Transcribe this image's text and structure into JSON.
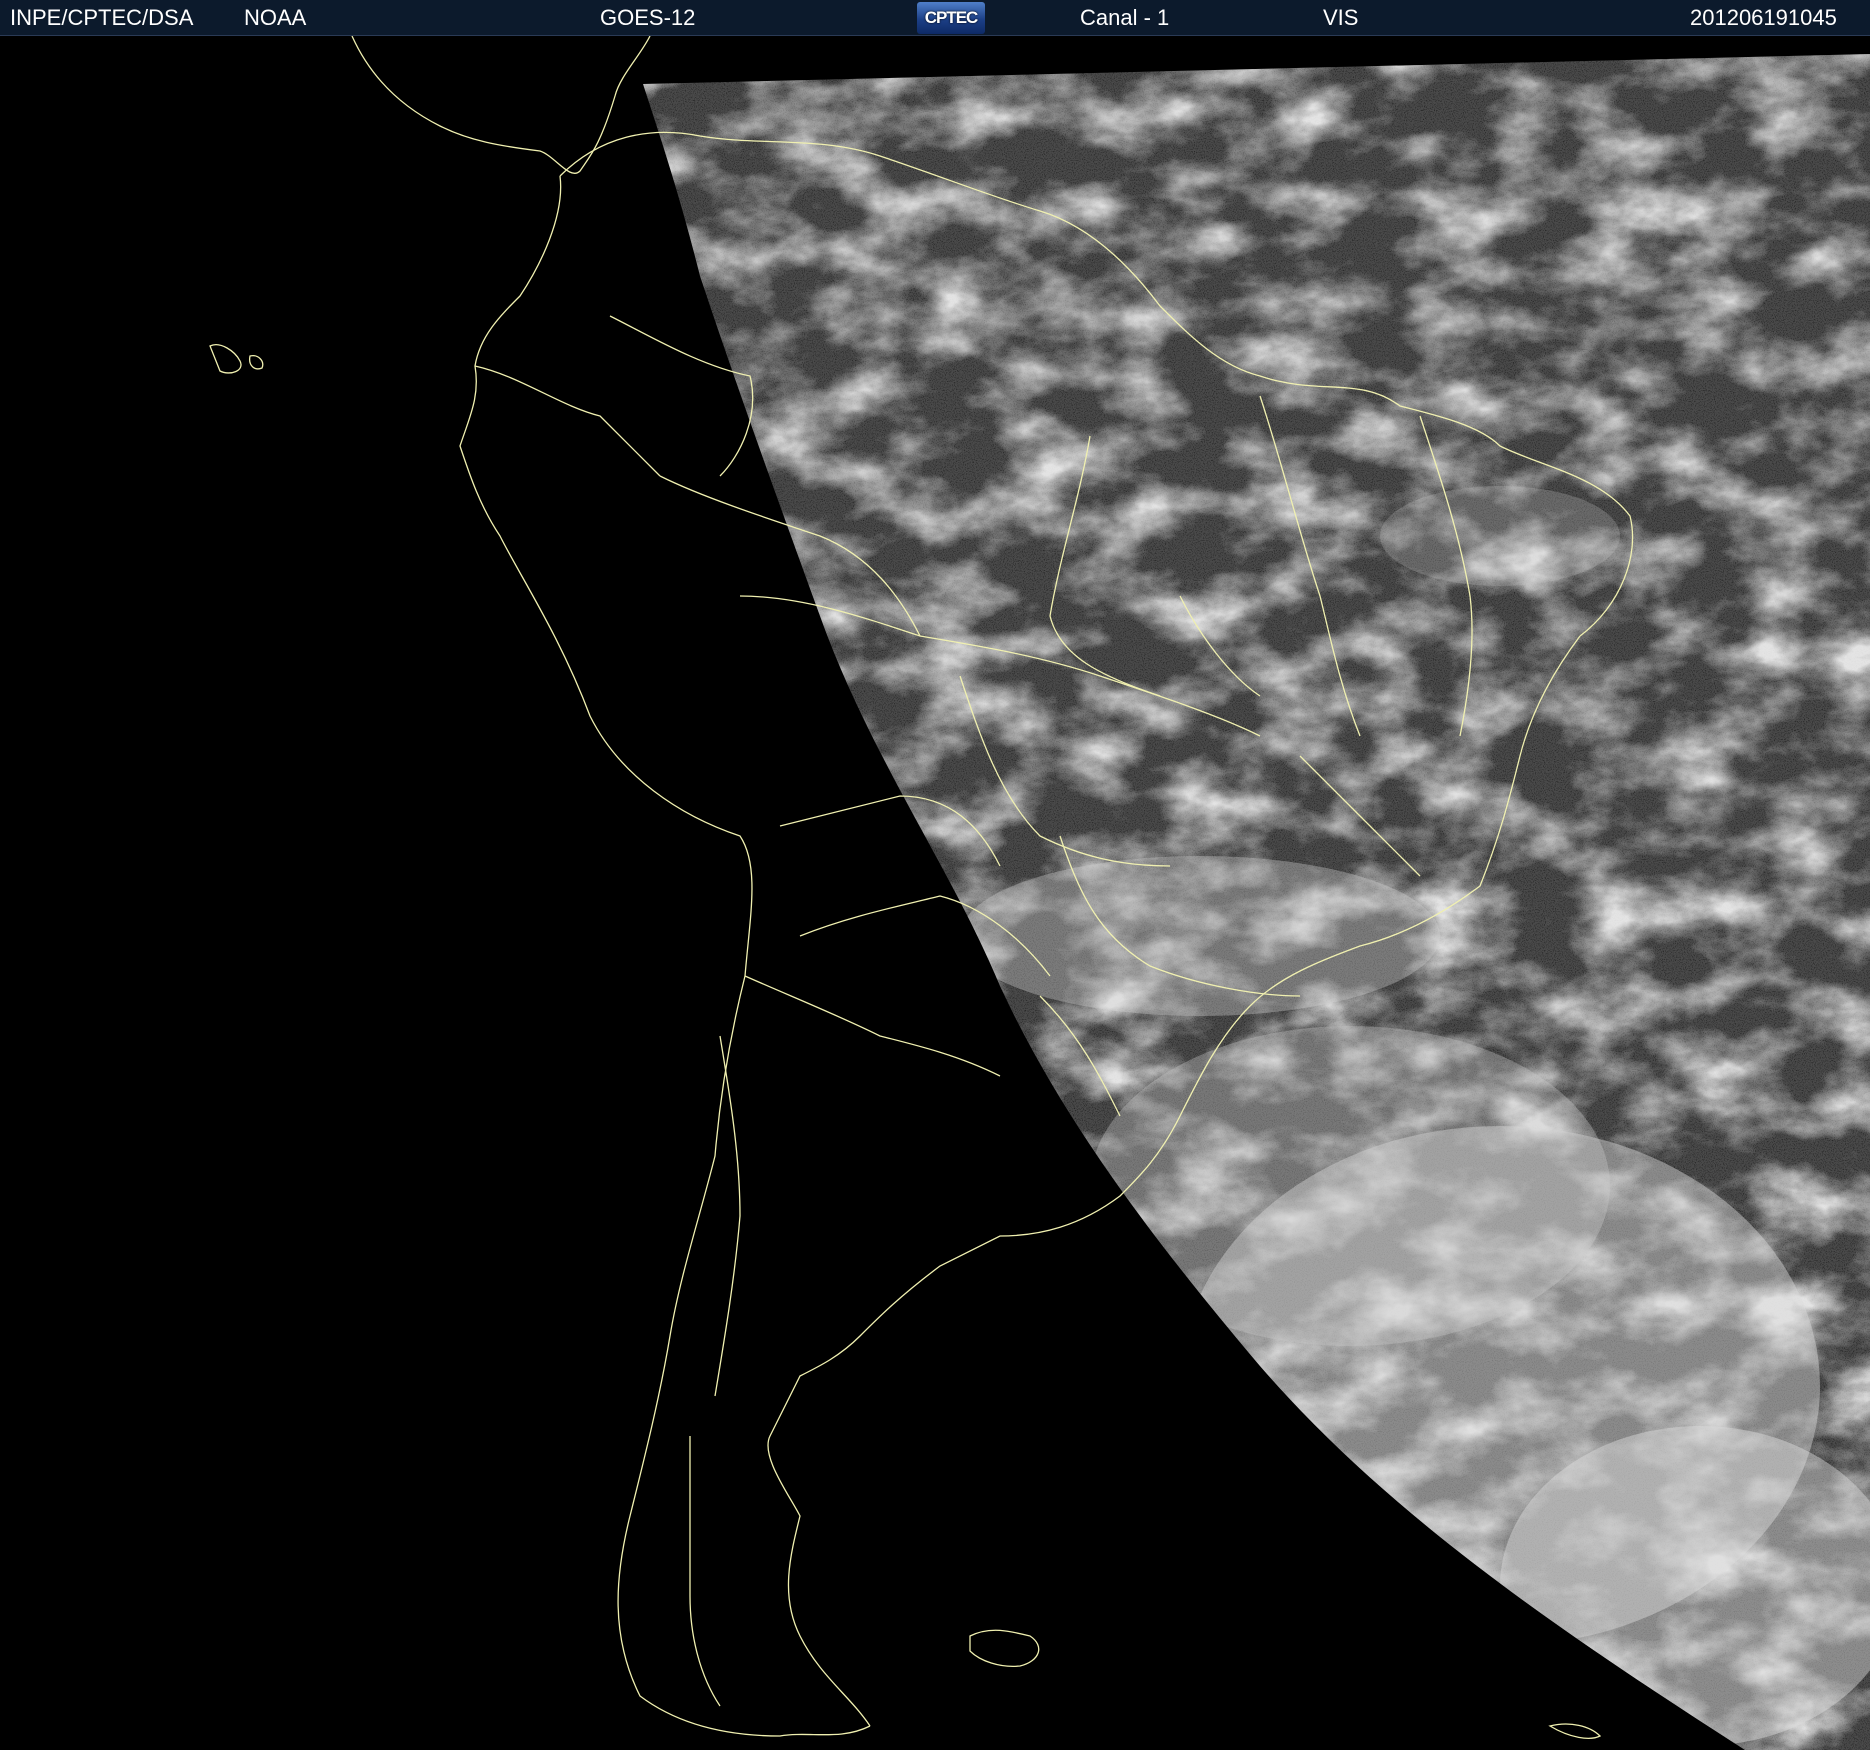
{
  "header": {
    "institution": "INPE/CPTEC/DSA",
    "agency": "NOAA",
    "satellite": "GOES-12",
    "logo_text": "CPTEC",
    "channel": "Canal - 1",
    "band": "VIS",
    "timestamp": "201206191045"
  },
  "colors": {
    "header_bg": "#0c1a2c",
    "border_lines": "#f0f0b0",
    "space_bg": "#000000"
  }
}
